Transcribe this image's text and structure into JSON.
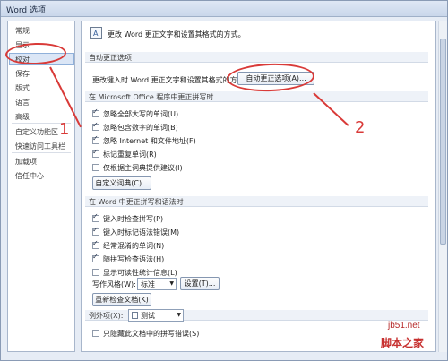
{
  "title": "Word 选项",
  "sidebar": {
    "items": [
      "常规",
      "显示",
      "校对",
      "保存",
      "版式",
      "语言",
      "高级",
      "自定义功能区",
      "快速访问工具栏",
      "加载项",
      "信任中心"
    ]
  },
  "main": {
    "intro": "更改 Word 更正文字和设置其格式的方式。",
    "autocorrect_header": "自动更正选项",
    "autocorrect_text": "更改键入时 Word 更正文字和设置其格式的方式:",
    "autocorrect_button": "自动更正选项(A)...",
    "office_header": "在 Microsoft Office 程序中更正拼写时",
    "office_items": [
      "忽略全部大写的单词(U)",
      "忽略包含数字的单词(B)",
      "忽略 Internet 和文件地址(F)",
      "标记重复单词(R)",
      "仅根据主词典提供建议(I)"
    ],
    "office_checks": [
      true,
      true,
      true,
      true,
      false
    ],
    "custom_dict_button": "自定义词典(C)...",
    "word_header": "在 Word 中更正拼写和语法时",
    "word_items": [
      "键入时检查拼写(P)",
      "键入时标记语法错误(M)",
      "经常混淆的单词(N)",
      "随拼写检查语法(H)",
      "显示可读性统计信息(L)"
    ],
    "word_checks": [
      true,
      true,
      true,
      true,
      false
    ],
    "writing_style_label": "写作风格(W):",
    "writing_style_value": "标准",
    "settings_button": "设置(T)...",
    "recheck_button": "重新检查文档(K)",
    "exceptions_label": "例外项(X):",
    "exceptions_value": "测试",
    "hide_spelling": "只隐藏此文档中的拼写错误(S)"
  },
  "annotations": {
    "one": "1",
    "two": "2"
  },
  "watermark": {
    "site": "jb51.net",
    "brand": "脚本之家"
  },
  "colors": {
    "accent": "#d93a38",
    "selection": "#dbe6f6"
  }
}
